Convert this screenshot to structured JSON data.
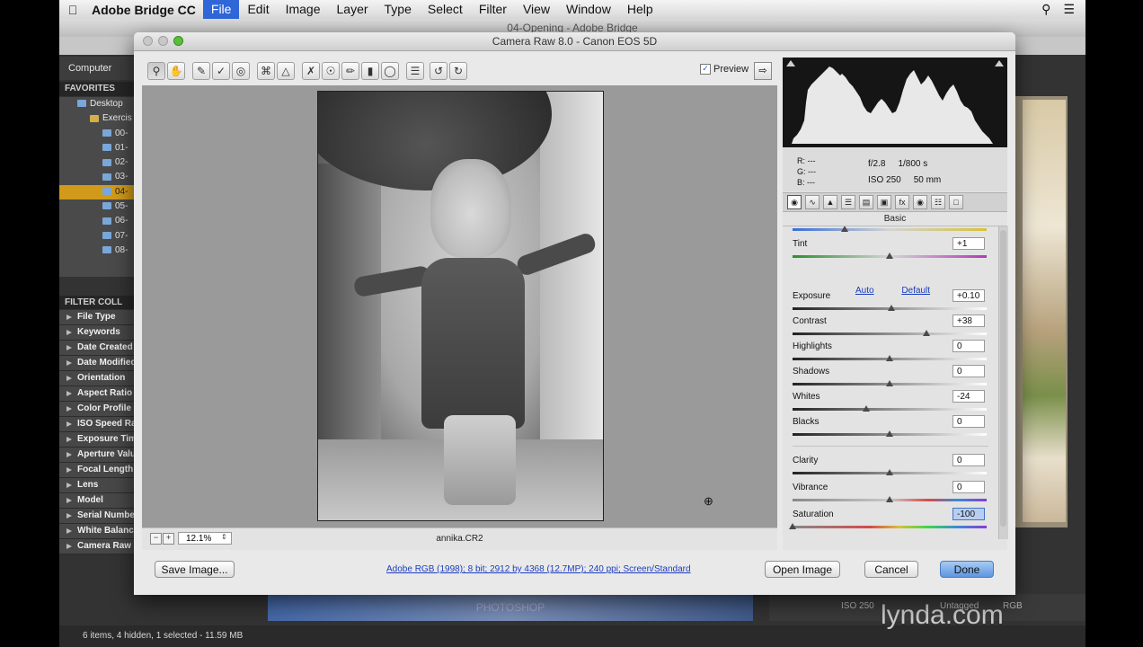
{
  "menubar": {
    "apple": "",
    "app_name": "Adobe Bridge CC",
    "menus": [
      "File",
      "Edit",
      "Image",
      "Layer",
      "Type",
      "Select",
      "Filter",
      "View",
      "Window",
      "Help"
    ],
    "active_menu": "File"
  },
  "bridge": {
    "window_title": "04-Opening - Adobe Bridge",
    "path_label": "Computer",
    "panel_tabs": "FAVORITES",
    "folders": [
      "Desktop",
      "Exercis",
      "00-",
      "01-",
      "02-",
      "03-",
      "04-",
      "05-",
      "06-",
      "07-",
      "08-"
    ],
    "selected_folder": "04-",
    "filter_tabs": "FILTER  COLL",
    "filters": [
      "File Type",
      "Keywords",
      "Date Created",
      "Date Modified",
      "Orientation",
      "Aspect Ratio",
      "Color Profile",
      "ISO Speed Ratings",
      "Exposure Time",
      "Aperture Value",
      "Focal Length",
      "Lens",
      "Model",
      "Serial Number",
      "White Balance",
      "Camera Raw"
    ],
    "status": "6 items, 4 hidden, 1 selected - 11.59 MB",
    "bottom_strip_text": "PHOTOSHOP",
    "meta_iso": "ISO 250",
    "meta_untagged": "Untagged",
    "meta_rgb": "RGB",
    "watermark": "lynda.com"
  },
  "camera_raw": {
    "title": "Camera Raw 8.0  -  Canon EOS 5D",
    "preview_label": "Preview",
    "preview_checked": true,
    "zoom": "12.1%",
    "filename": "annika.CR2",
    "rgb": {
      "r": "R:  ---",
      "g": "G:  ---",
      "b": "B:  ---"
    },
    "exif": {
      "aperture": "f/2.8",
      "shutter": "1/800 s",
      "iso": "ISO 250",
      "focal": "50 mm"
    },
    "panel_name": "Basic",
    "auto_label": "Auto",
    "default_label": "Default",
    "sliders": [
      {
        "label": "Tint",
        "value": "+1",
        "level": 0.5
      },
      {
        "label": "Exposure",
        "value": "+0.10",
        "level": 0.51
      },
      {
        "label": "Contrast",
        "value": "+38",
        "level": 0.69
      },
      {
        "label": "Highlights",
        "value": "0",
        "level": 0.5
      },
      {
        "label": "Shadows",
        "value": "0",
        "level": 0.5
      },
      {
        "label": "Whites",
        "value": "-24",
        "level": 0.38
      },
      {
        "label": "Blacks",
        "value": "0",
        "level": 0.5
      },
      {
        "label": "Clarity",
        "value": "0",
        "level": 0.5
      },
      {
        "label": "Vibrance",
        "value": "0",
        "level": 0.5
      },
      {
        "label": "Saturation",
        "value": "-100",
        "level": 0.0
      }
    ],
    "temperature_level": 0.27,
    "buttons": {
      "save": "Save Image...",
      "workflow": "Adobe RGB (1998); 8 bit; 2912 by 4368 (12.7MP); 240 ppi; Screen/Standard",
      "open": "Open Image",
      "cancel": "Cancel",
      "done": "Done"
    }
  }
}
